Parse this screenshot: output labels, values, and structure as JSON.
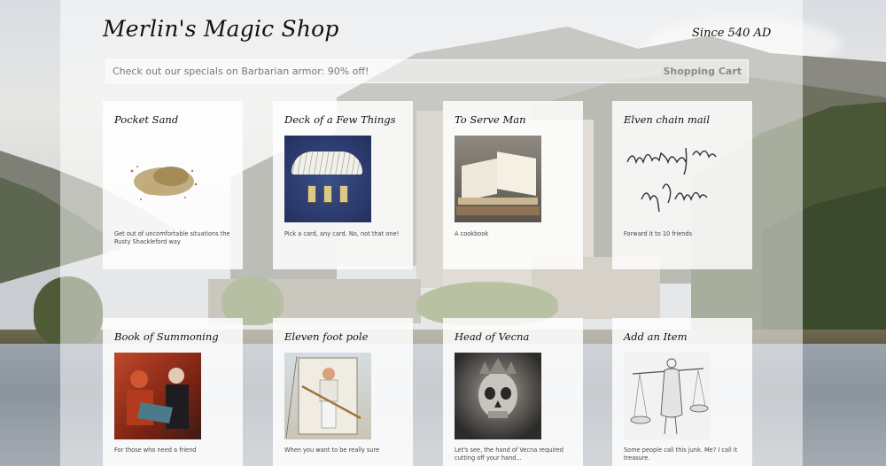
{
  "header": {
    "title": "Merlin's Magic Shop",
    "since": "Since 540 AD"
  },
  "banner": {
    "message": "Check out our specials on Barbarian armor: 90% off!",
    "cart_label": "Shopping Cart"
  },
  "cards": [
    {
      "title": "Pocket Sand",
      "image": "sand-pile-image",
      "description": "Get out of uncomfortable situations the Rusty Shackleford way"
    },
    {
      "title": "Deck of a Few Things",
      "image": "card-deck-image",
      "description": "Pick a card, any card. No, not that one!"
    },
    {
      "title": "To Serve Man",
      "image": "open-book-image",
      "description": "A cookbook"
    },
    {
      "title": "Elven chain mail",
      "image": "elvish-script-image",
      "description": "Forward it to 10 friends"
    },
    {
      "title": "Book of Summoning",
      "image": "summoning-painting-image",
      "description": "For those who need a friend"
    },
    {
      "title": "Eleven foot pole",
      "image": "pole-illustration-image",
      "description": "When you want to be really sure"
    },
    {
      "title": "Head of Vecna",
      "image": "skull-crown-image",
      "description": "Let's see, the hand of Vecna required cutting off your hand..."
    },
    {
      "title": "Add an Item",
      "image": "merchant-sketch-image",
      "description": "Some people call this junk. Me? I call it treasure."
    }
  ]
}
